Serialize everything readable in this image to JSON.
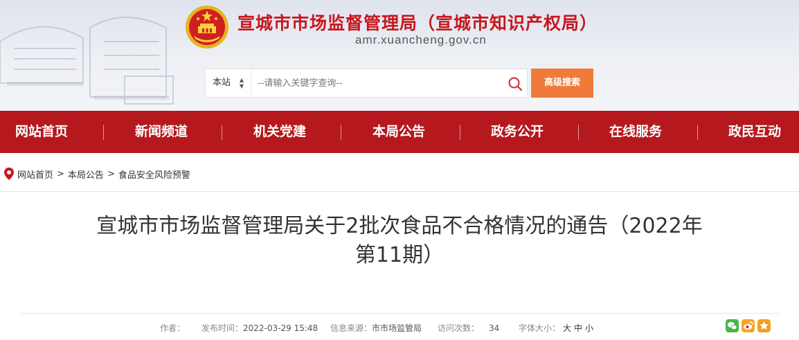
{
  "header": {
    "title": "宣城市市场监督管理局（宣城市知识产权局）",
    "domain": "amr.xuancheng.gov.cn",
    "brand_red": "#c8161d",
    "emblem_icon": "national-emblem-icon"
  },
  "search": {
    "scope": "本站",
    "placeholder": "--请输入关键字查询--",
    "advanced_label": "高级搜索",
    "accent": "#f07a3a"
  },
  "nav": {
    "color": "#b5191d",
    "items": [
      "网站首页",
      "新闻频道",
      "机关党建",
      "本局公告",
      "政务公开",
      "在线服务",
      "政民互动"
    ]
  },
  "breadcrumb": {
    "items": [
      "网站首页",
      "本局公告",
      "食品安全风险预警"
    ],
    "separator": ">"
  },
  "article": {
    "title_line1": "宣城市市场监督管理局关于2批次食品不合格情况的通告（2022年",
    "title_line2": "第11期）",
    "author_label": "作者：",
    "author": "",
    "date_label": "发布时间：",
    "date": "2022-03-29 15:48",
    "source_label": "信息来源：",
    "source": "市市场监管局",
    "views_label": "访问次数：",
    "views": "34",
    "font_label": "字体大小：",
    "font_sizes": [
      "大",
      "中",
      "小"
    ]
  },
  "share": {
    "icons": [
      "wechat-icon",
      "weibo-icon",
      "favorite-star-icon"
    ]
  }
}
